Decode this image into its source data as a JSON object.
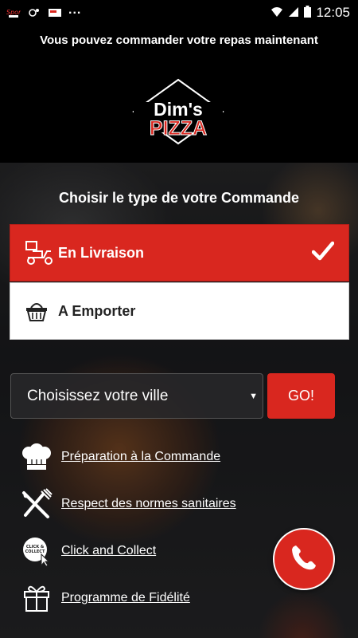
{
  "status_bar": {
    "time": "12:05",
    "left_icons": [
      "sport-badge-icon",
      "settings-notification-icon",
      "app-notification-icon"
    ],
    "overflow": "...",
    "right_icons": [
      "wifi-icon",
      "signal-icon",
      "battery-icon"
    ]
  },
  "header": {
    "banner": "Vous pouvez commander votre repas maintenant",
    "logo": {
      "line1": "Dim's",
      "line2": "PIZZA"
    }
  },
  "order_type": {
    "title": "Choisir le type de votre Commande",
    "options": [
      {
        "label": "En Livraison",
        "icon": "delivery-scooter-icon",
        "selected": true
      },
      {
        "label": "A Emporter",
        "icon": "basket-icon",
        "selected": false
      }
    ]
  },
  "city": {
    "placeholder": "Choisissez votre ville",
    "go_label": "GO!"
  },
  "features": [
    {
      "label": "Préparation à la Commande",
      "icon": "chef-hat-icon"
    },
    {
      "label": "Respect des normes sanitaires",
      "icon": "fork-knife-icon"
    },
    {
      "label": "Click and Collect",
      "icon": "click-and-collect-icon",
      "icon_text": "CLICK & COLLECT"
    },
    {
      "label": "Programme de Fidélité",
      "icon": "gift-icon"
    }
  ],
  "colors": {
    "accent": "#d9271f",
    "background": "#000000",
    "text_light": "#ffffff"
  }
}
